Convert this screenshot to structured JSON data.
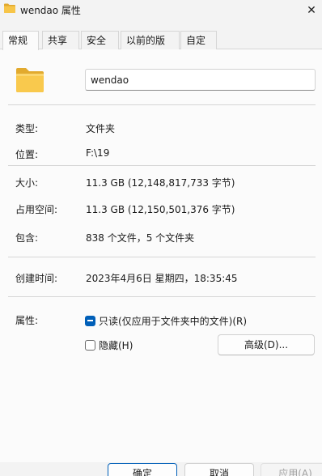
{
  "window": {
    "title": "wendao 属性",
    "close_glyph": "✕",
    "icon": "folder-icon"
  },
  "tabs": [
    {
      "label": "常规",
      "active": true
    },
    {
      "label": "共享",
      "active": false
    },
    {
      "label": "安全",
      "active": false
    },
    {
      "label": "以前的版本",
      "active": false
    },
    {
      "label": "自定义",
      "active": false
    }
  ],
  "general": {
    "folder_name": "wendao",
    "type_label": "类型:",
    "type_value": "文件夹",
    "location_label": "位置:",
    "location_value": "F:\\19",
    "size_label": "大小:",
    "size_value": "11.3 GB (12,148,817,733 字节)",
    "size_on_disk_label": "占用空间:",
    "size_on_disk_value": "11.3 GB (12,150,501,376 字节)",
    "contains_label": "包含:",
    "contains_value": "838 个文件，5 个文件夹",
    "created_label": "创建时间:",
    "created_value": "2023年4月6日 星期四，18:35:45",
    "attributes_label": "属性:",
    "readonly_label": "只读(仅应用于文件夹中的文件)(R)",
    "readonly_state": "indeterminate",
    "hidden_label": "隐藏(H)",
    "hidden_state": "unchecked",
    "advanced_button": "高级(D)..."
  },
  "footer": {
    "ok_button": "确定",
    "cancel_button": "取消",
    "apply_button": "应用(A)"
  },
  "colors": {
    "accent": "#005fb8",
    "folder": "#f7c548"
  }
}
